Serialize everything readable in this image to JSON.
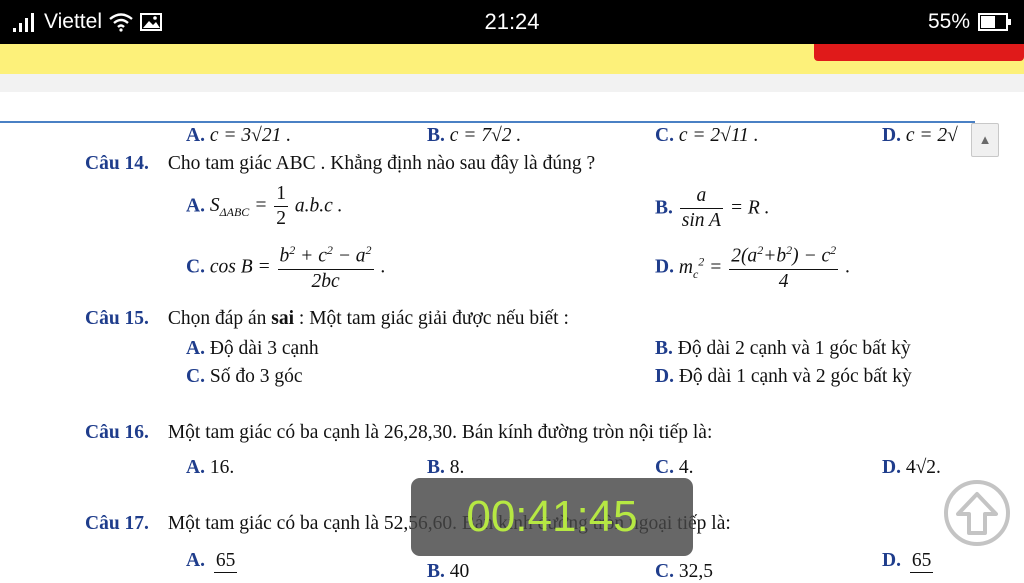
{
  "status": {
    "carrier": "Viettel",
    "time": "21:24",
    "battery": "55%",
    "icons": [
      "signal-icon",
      "wifi-icon",
      "image-icon",
      "battery-icon"
    ]
  },
  "colors": {
    "label": "#1f3d8c",
    "yellow_bar": "#fdf17a",
    "red_button": "#e01a1a",
    "divider": "#4a80c4",
    "timer_text": "#b6e843"
  },
  "q13": {
    "a_label": "A.",
    "a_text": "c = 3√21 .",
    "b_label": "B.",
    "b_text": "c = 7√2 .",
    "c_label": "C.",
    "c_text": "c = 2√11 .",
    "d_label": "D.",
    "d_text": "c = 2√"
  },
  "q14": {
    "label": "Câu 14.",
    "text": "Cho tam giác ABC . Khẳng định nào sau đây là đúng ?",
    "a_label": "A.",
    "b_label": "B.",
    "c_label": "C.",
    "d_label": "D."
  },
  "q15": {
    "label": "Câu 15.",
    "text_pre": "Chọn đáp án ",
    "text_bold": "sai",
    "text_post": " : Một tam giác giải được nếu biết :",
    "a_label": "A.",
    "a_text": "Độ dài 3 cạnh",
    "b_label": "B.",
    "b_text": "Độ dài 2 cạnh và 1 góc bất kỳ",
    "c_label": "C.",
    "c_text": "Số đo 3 góc",
    "d_label": "D.",
    "d_text": "Độ dài 1 cạnh và 2 góc bất kỳ"
  },
  "q16": {
    "label": "Câu 16.",
    "text": "Một tam giác có ba cạnh là 26,28,30. Bán kính đường tròn nội tiếp là:",
    "a_label": "A.",
    "a_text": "16.",
    "b_label": "B.",
    "b_text": "8.",
    "c_label": "C.",
    "c_text": "4.",
    "d_label": "D.",
    "d_text": "4√2."
  },
  "q17": {
    "label": "Câu 17.",
    "text": "Một tam giác có ba cạnh là 52,56,60. Bán kính đường tròn ngoại tiếp là:",
    "a_label": "A.",
    "a_num": "65",
    "b_label": "B.",
    "b_text": "40",
    "c_label": "C.",
    "c_text": "32,5",
    "d_label": "D.",
    "d_num": "65"
  },
  "timer": "00:41:45"
}
